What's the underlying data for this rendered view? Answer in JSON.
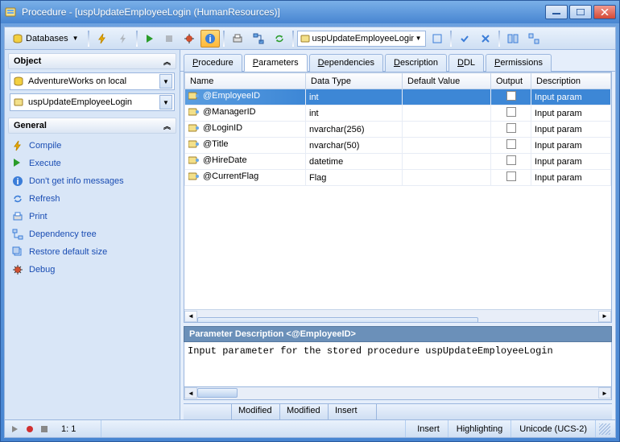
{
  "window": {
    "title": "Procedure - [uspUpdateEmployeeLogin (HumanResources)]"
  },
  "toolbar": {
    "databases": "Databases",
    "proc_dropdown": "uspUpdateEmployeeLogin"
  },
  "sidebar": {
    "object_header": "Object",
    "general_header": "General",
    "db_selector": "AdventureWorks on local",
    "proc_selector": "uspUpdateEmployeeLogin",
    "actions": [
      {
        "label": "Compile",
        "icon": "bolt",
        "color": "#f0b000"
      },
      {
        "label": "Execute",
        "icon": "play",
        "color": "#2a9c2a"
      },
      {
        "label": "Don't get info messages",
        "icon": "info",
        "color": "#3b7dd8"
      },
      {
        "label": "Refresh",
        "icon": "refresh",
        "color": "#3b7dd8"
      },
      {
        "label": "Print",
        "icon": "print",
        "color": "#3b7dd8"
      },
      {
        "label": "Dependency tree",
        "icon": "tree",
        "color": "#3b7dd8"
      },
      {
        "label": "Restore default size",
        "icon": "restore",
        "color": "#3b7dd8"
      },
      {
        "label": "Debug",
        "icon": "bug",
        "color": "#d05030"
      }
    ]
  },
  "tabs": [
    "Procedure",
    "Parameters",
    "Dependencies",
    "Description",
    "DDL",
    "Permissions"
  ],
  "active_tab": 1,
  "grid": {
    "columns": [
      "Name",
      "Data Type",
      "Default Value",
      "Output",
      "Description"
    ],
    "rows": [
      {
        "name": "@EmployeeID",
        "type": "int",
        "default": "",
        "output": false,
        "desc": "Input param"
      },
      {
        "name": "@ManagerID",
        "type": "int",
        "default": "",
        "output": false,
        "desc": "Input param"
      },
      {
        "name": "@LoginID",
        "type": "nvarchar(256)",
        "default": "",
        "output": false,
        "desc": "Input param"
      },
      {
        "name": "@Title",
        "type": "nvarchar(50)",
        "default": "",
        "output": false,
        "desc": "Input param"
      },
      {
        "name": "@HireDate",
        "type": "datetime",
        "default": "",
        "output": false,
        "desc": "Input param"
      },
      {
        "name": "@CurrentFlag",
        "type": "Flag",
        "default": "",
        "output": false,
        "desc": "Input param"
      }
    ],
    "selected_row": 0
  },
  "desc_panel": {
    "title": "Parameter Description <@EmployeeID>",
    "body": "Input parameter for the stored procedure uspUpdateEmployeeLogin"
  },
  "tabstrip": {
    "cells": [
      "",
      "Modified",
      "Modified",
      "Insert"
    ]
  },
  "statusbar": {
    "pos": "1:   1",
    "cells": [
      "Insert",
      "Highlighting",
      "Unicode (UCS-2)"
    ]
  }
}
